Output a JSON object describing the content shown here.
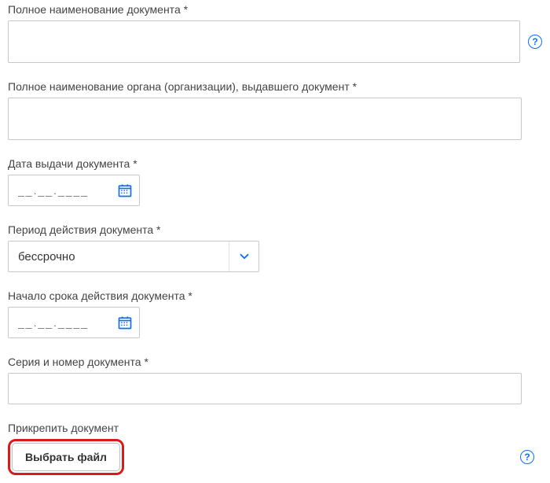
{
  "fields": {
    "doc_name": {
      "label": "Полное наименование документа *",
      "value": ""
    },
    "issuer": {
      "label": "Полное наименование органа (организации), выдавшего документ *",
      "value": ""
    },
    "issue_date": {
      "label": "Дата выдачи документа *",
      "placeholder": "__.__.____"
    },
    "validity": {
      "label": "Период действия документа *",
      "selected": "бессрочно"
    },
    "start_date": {
      "label": "Начало срока действия документа *",
      "placeholder": "__.__.____"
    },
    "serial": {
      "label": "Серия и номер документа *",
      "value": ""
    },
    "attach": {
      "label": "Прикрепить документ",
      "button": "Выбрать файл"
    }
  },
  "icons": {
    "help": "?"
  }
}
